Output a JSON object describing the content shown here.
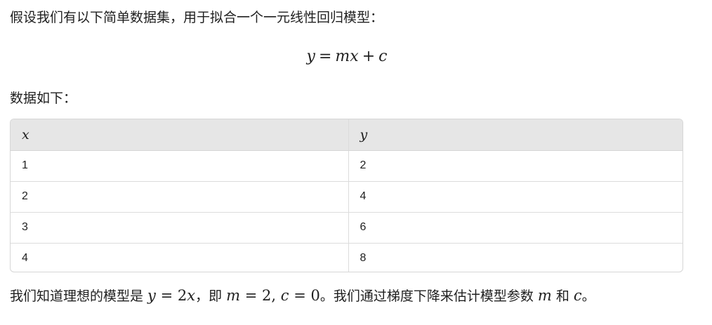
{
  "intro": {
    "text": "假设我们有以下简单数据集，用于拟合一个一元线性回归模型："
  },
  "equation": {
    "lhs": "y",
    "eq": "=",
    "m": "m",
    "x": "x",
    "plus": "+",
    "c": "c"
  },
  "data_label": {
    "text": "数据如下："
  },
  "table": {
    "headers": [
      "x",
      "y"
    ],
    "rows": [
      [
        "1",
        "2"
      ],
      [
        "2",
        "4"
      ],
      [
        "3",
        "6"
      ],
      [
        "4",
        "8"
      ]
    ]
  },
  "conclusion": {
    "part1": "我们知道理想的模型是 ",
    "model_y": "y",
    "model_eq": " = ",
    "model_coef": "2",
    "model_x": "x",
    "part2": "，即 ",
    "m_var": "m",
    "m_eq": " = ",
    "m_val": "2",
    "comma": ", ",
    "c_var": "c",
    "c_eq": " = ",
    "c_val": "0",
    "part3": "。我们通过梯度下降来估计模型参数 ",
    "param_m": "m",
    "part4": " 和 ",
    "param_c": "c",
    "part5": "。"
  }
}
